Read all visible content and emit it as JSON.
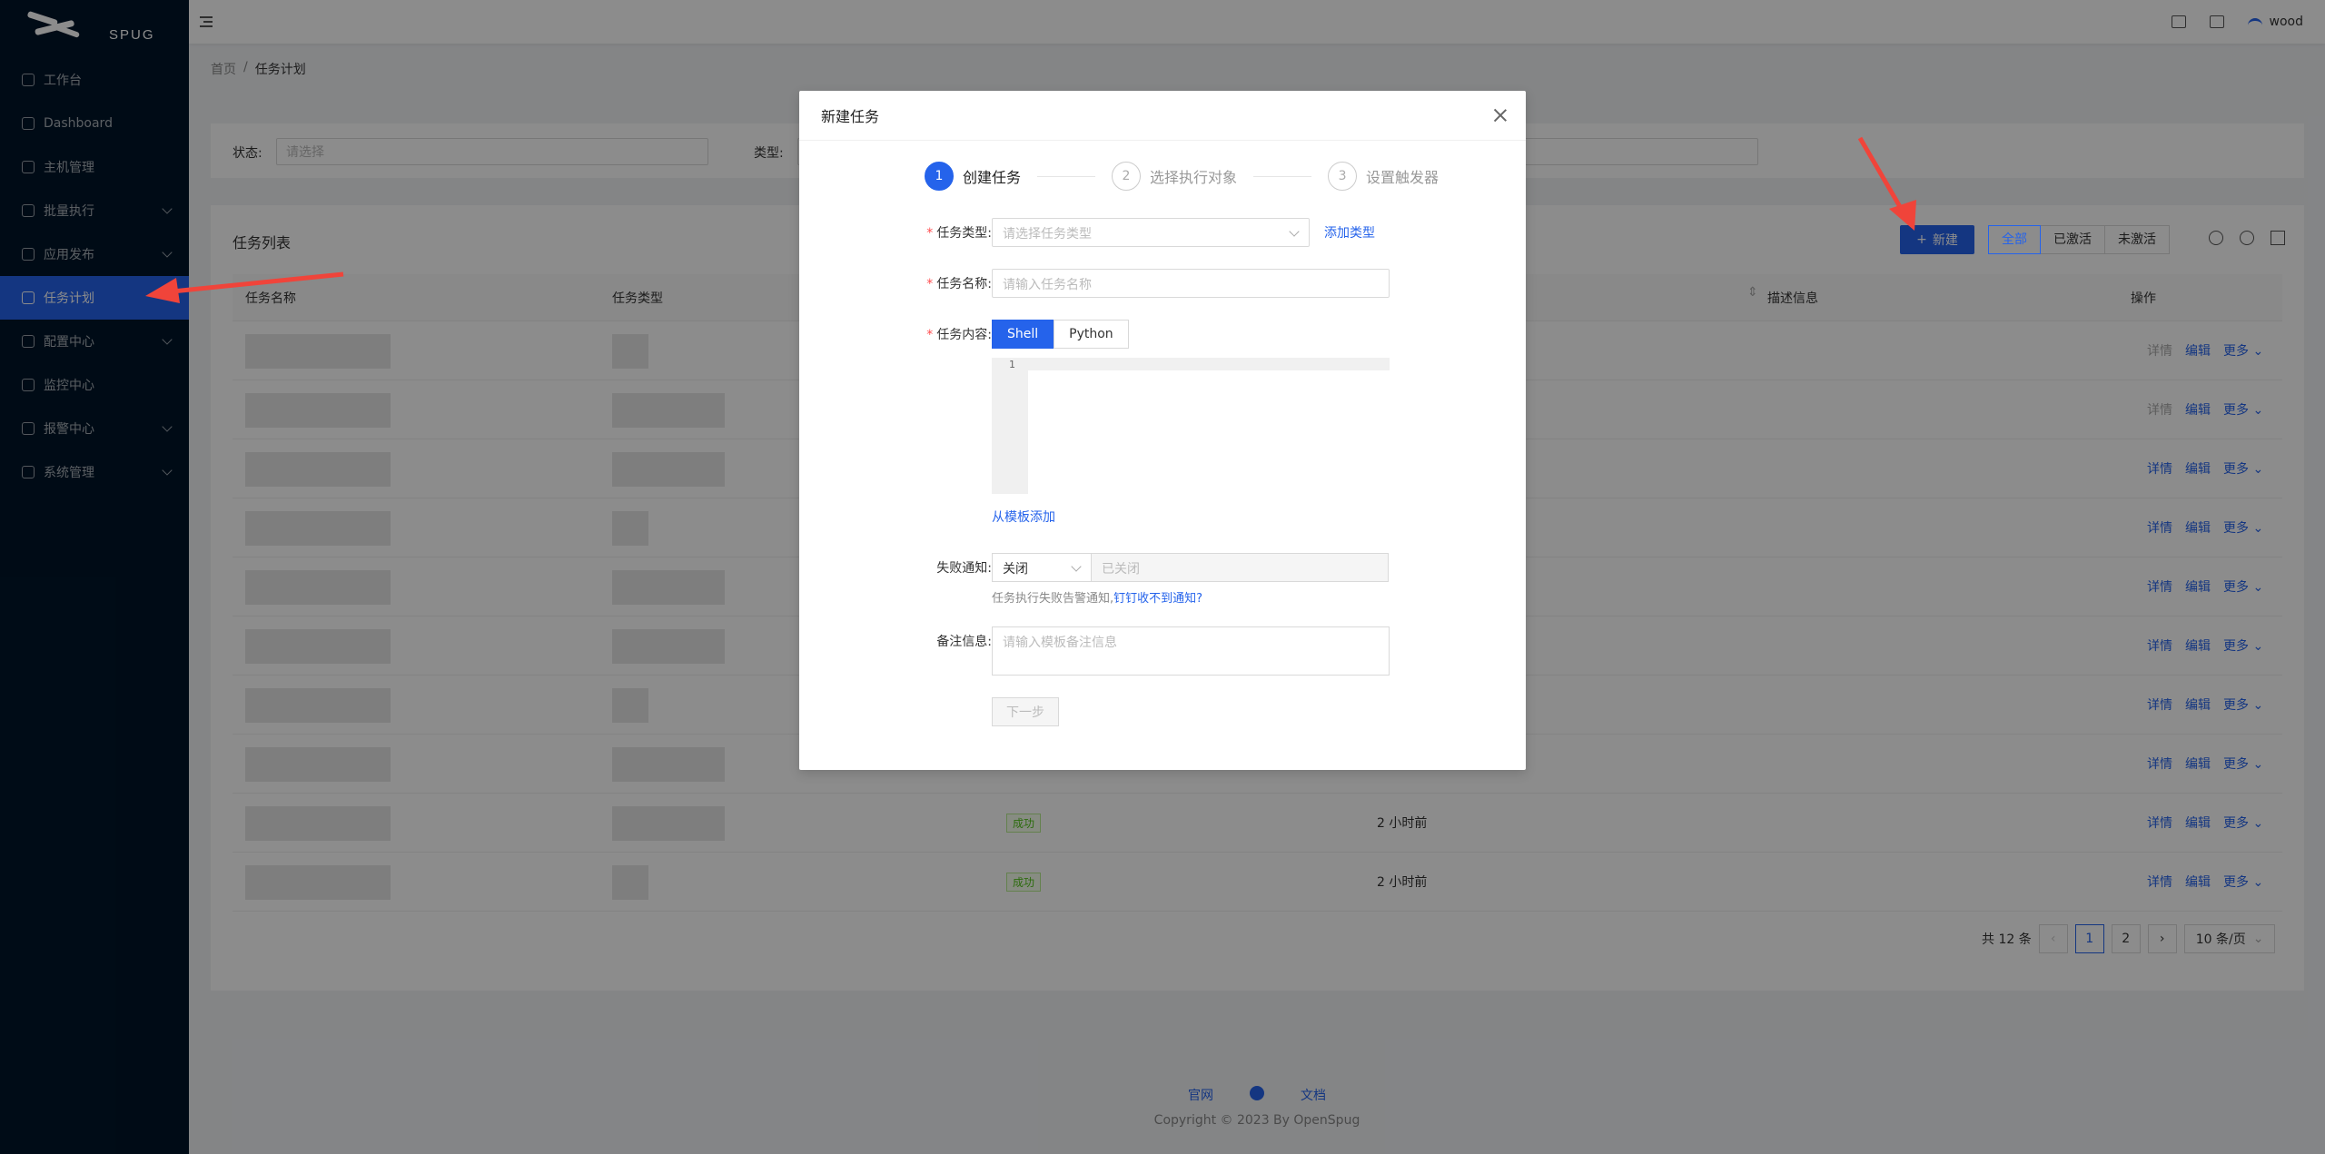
{
  "app": {
    "logo_text": "SPUG"
  },
  "sidebar": {
    "items": [
      {
        "label": "工作台",
        "icon": "desktop-icon",
        "has_children": false,
        "active": false
      },
      {
        "label": "Dashboard",
        "icon": "dashboard-icon",
        "has_children": false,
        "active": false
      },
      {
        "label": "主机管理",
        "icon": "cloud-server-icon",
        "has_children": false,
        "active": false
      },
      {
        "label": "批量执行",
        "icon": "code-icon",
        "has_children": true,
        "active": false
      },
      {
        "label": "应用发布",
        "icon": "flag-icon",
        "has_children": true,
        "active": false
      },
      {
        "label": "任务计划",
        "icon": "schedule-icon",
        "has_children": false,
        "active": true
      },
      {
        "label": "配置中心",
        "icon": "deployment-icon",
        "has_children": true,
        "active": false
      },
      {
        "label": "监控中心",
        "icon": "monitor-icon",
        "has_children": false,
        "active": false
      },
      {
        "label": "报警中心",
        "icon": "alert-icon",
        "has_children": true,
        "active": false
      },
      {
        "label": "系统管理",
        "icon": "setting-icon",
        "has_children": true,
        "active": false
      }
    ]
  },
  "header": {
    "username": "wood"
  },
  "breadcrumb": {
    "home": "首页",
    "separator": "/",
    "current": "任务计划"
  },
  "filters": {
    "status_label": "状态:",
    "status_placeholder": "请选择",
    "type_label": "类型:"
  },
  "table": {
    "title": "任务列表",
    "new_button": "新建",
    "radio": [
      "全部",
      "已激活",
      "未激活"
    ],
    "columns": [
      "任务名称",
      "任务类型",
      "描述信息",
      "操作"
    ],
    "rows": [
      {
        "status": "",
        "time": "",
        "ops": [
          "详情",
          "编辑",
          "更多"
        ]
      },
      {
        "status": "",
        "time": "",
        "ops": [
          "详情",
          "编辑",
          "更多"
        ]
      },
      {
        "status": "",
        "time": "",
        "ops": [
          "详情",
          "编辑",
          "更多"
        ]
      },
      {
        "status": "",
        "time": "",
        "ops": [
          "详情",
          "编辑",
          "更多"
        ]
      },
      {
        "status": "",
        "time": "",
        "ops": [
          "详情",
          "编辑",
          "更多"
        ]
      },
      {
        "status": "",
        "time": "",
        "ops": [
          "详情",
          "编辑",
          "更多"
        ]
      },
      {
        "status": "",
        "time": "",
        "ops": [
          "详情",
          "编辑",
          "更多"
        ]
      },
      {
        "status": "",
        "time": "",
        "ops": [
          "详情",
          "编辑",
          "更多"
        ]
      },
      {
        "status": "成功",
        "time": "2 小时前",
        "ops": [
          "详情",
          "编辑",
          "更多"
        ]
      },
      {
        "status": "成功",
        "time": "2 小时前",
        "ops": [
          "详情",
          "编辑",
          "更多"
        ]
      }
    ],
    "pager": {
      "total": "共 12 条",
      "pages": [
        "1",
        "2"
      ],
      "current": "1",
      "page_size": "10 条/页"
    }
  },
  "footer": {
    "links": [
      "官网",
      "文档"
    ],
    "copyright": "Copyright © 2023 By OpenSpug"
  },
  "modal": {
    "title": "新建任务",
    "steps": [
      {
        "num": "1",
        "label": "创建任务"
      },
      {
        "num": "2",
        "label": "选择执行对象"
      },
      {
        "num": "3",
        "label": "设置触发器"
      }
    ],
    "type_label": "任务类型:",
    "type_placeholder": "请选择任务类型",
    "add_type": "添加类型",
    "name_label": "任务名称:",
    "name_placeholder": "请输入任务名称",
    "content_label": "任务内容:",
    "lang_tabs": [
      "Shell",
      "Python"
    ],
    "editor_line": "1",
    "from_template": "从模板添加",
    "notify_label": "失败通知:",
    "notify_value": "关闭",
    "notify_disabled": "已关闭",
    "notify_help": "任务执行失败告警通知,",
    "notify_help_link": "钉钉收不到通知?",
    "remark_label": "备注信息:",
    "remark_placeholder": "请输入模板备注信息",
    "next_button": "下一步"
  },
  "colors": {
    "primary": "#2563eb",
    "sidebar_bg": "#001529",
    "arrow": "#f0443a"
  }
}
